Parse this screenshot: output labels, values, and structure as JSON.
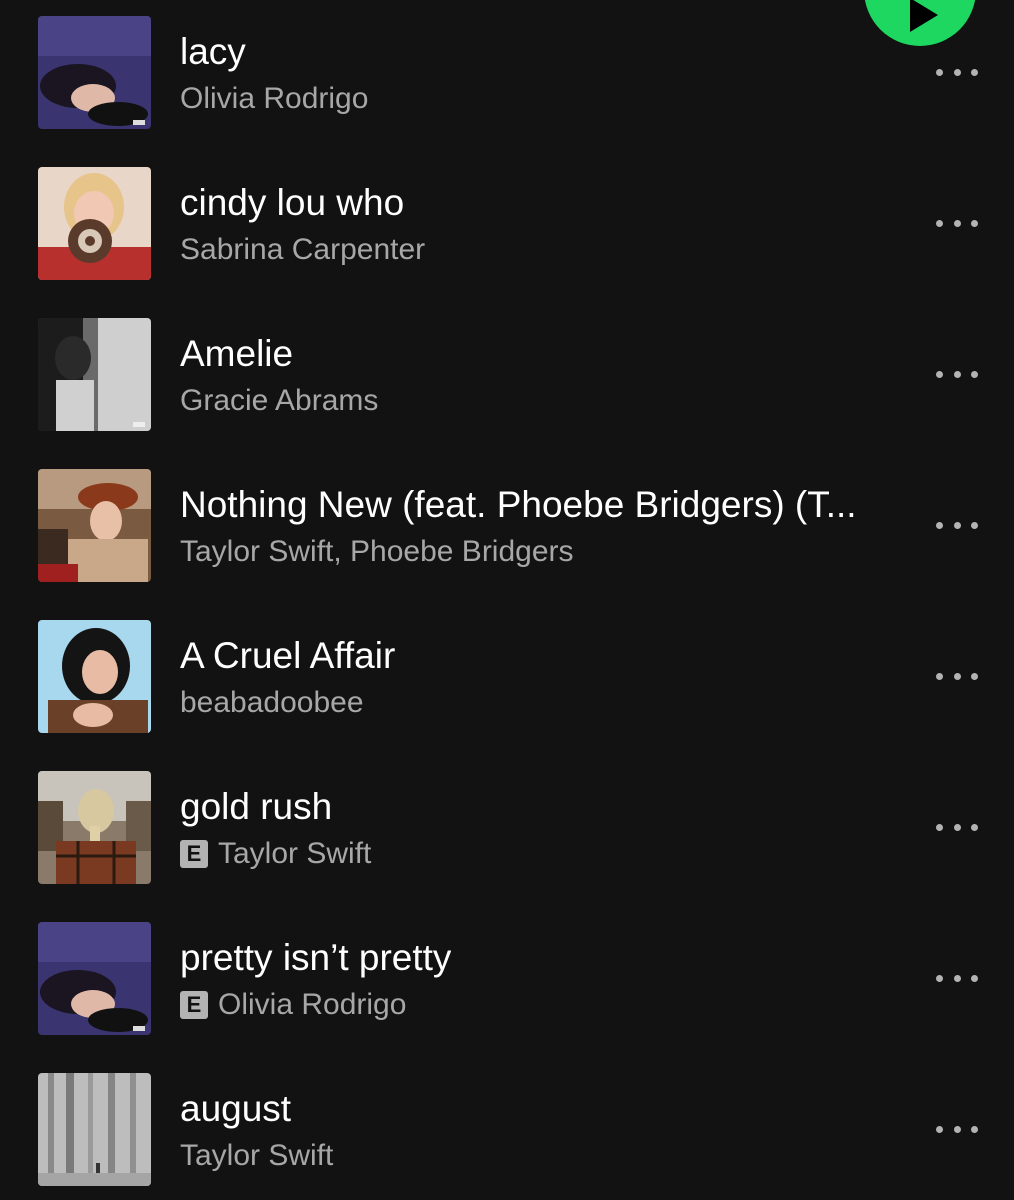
{
  "playlist": {
    "tracks": [
      {
        "title": "lacy",
        "artist": "Olivia Rodrigo",
        "explicit": false,
        "art": "guts"
      },
      {
        "title": "cindy lou who",
        "artist": "Sabrina Carpenter",
        "explicit": false,
        "art": "sabrina"
      },
      {
        "title": "Amelie",
        "artist": "Gracie Abrams",
        "explicit": false,
        "art": "gracie"
      },
      {
        "title": "Nothing New (feat. Phoebe Bridgers) (T...",
        "artist": "Taylor Swift, Phoebe Bridgers",
        "explicit": false,
        "art": "red"
      },
      {
        "title": "A Cruel Affair",
        "artist": "beabadoobee",
        "explicit": false,
        "art": "bea"
      },
      {
        "title": "gold rush",
        "artist": "Taylor Swift",
        "explicit": true,
        "art": "evermore"
      },
      {
        "title": "pretty isn’t pretty",
        "artist": "Olivia Rodrigo",
        "explicit": true,
        "art": "guts"
      },
      {
        "title": "august",
        "artist": "Taylor Swift",
        "explicit": false,
        "art": "folklore"
      }
    ],
    "explicit_label": "E"
  },
  "colors": {
    "background": "#121212",
    "accent": "#1ed760",
    "title_text": "#ffffff",
    "subtitle_text": "#a7a7a7"
  },
  "icons": {
    "play": "play-icon",
    "more": "more-options-icon",
    "explicit": "explicit-badge"
  }
}
